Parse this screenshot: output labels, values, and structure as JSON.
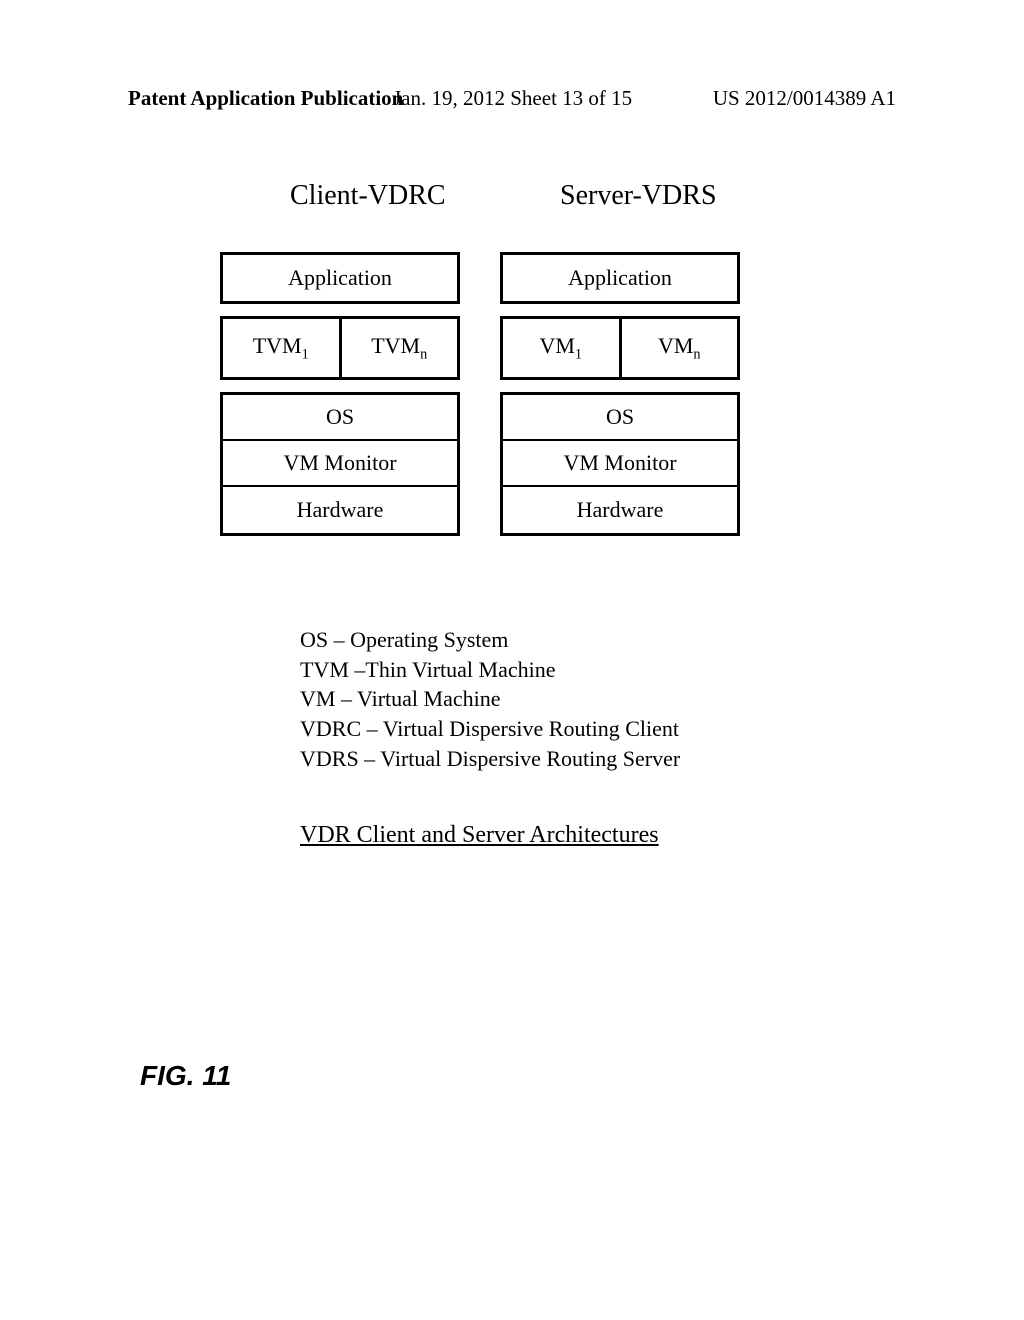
{
  "header": {
    "left": "Patent Application Publication",
    "center": "Jan. 19, 2012  Sheet 13 of 15",
    "right": "US 2012/0014389 A1"
  },
  "columns": {
    "client_title": "Client-VDRC",
    "server_title": "Server-VDRS"
  },
  "client_stack": {
    "application": "Application",
    "vm1": "TVM",
    "vm1_sub": "1",
    "vmn": "TVM",
    "vmn_sub": "n",
    "os": "OS",
    "vm_monitor": "VM Monitor",
    "hardware": "Hardware"
  },
  "server_stack": {
    "application": "Application",
    "vm1": "VM",
    "vm1_sub": "1",
    "vmn": "VM",
    "vmn_sub": "n",
    "os": "OS",
    "vm_monitor": "VM Monitor",
    "hardware": "Hardware"
  },
  "legend": {
    "l1": "OS – Operating System",
    "l2": "TVM –Thin Virtual Machine",
    "l3": "VM – Virtual Machine",
    "l4": "VDRC – Virtual Dispersive Routing Client",
    "l5": "VDRS – Virtual Dispersive Routing Server"
  },
  "caption": "VDR Client and Server Architectures",
  "figure_label": "FIG. 11"
}
